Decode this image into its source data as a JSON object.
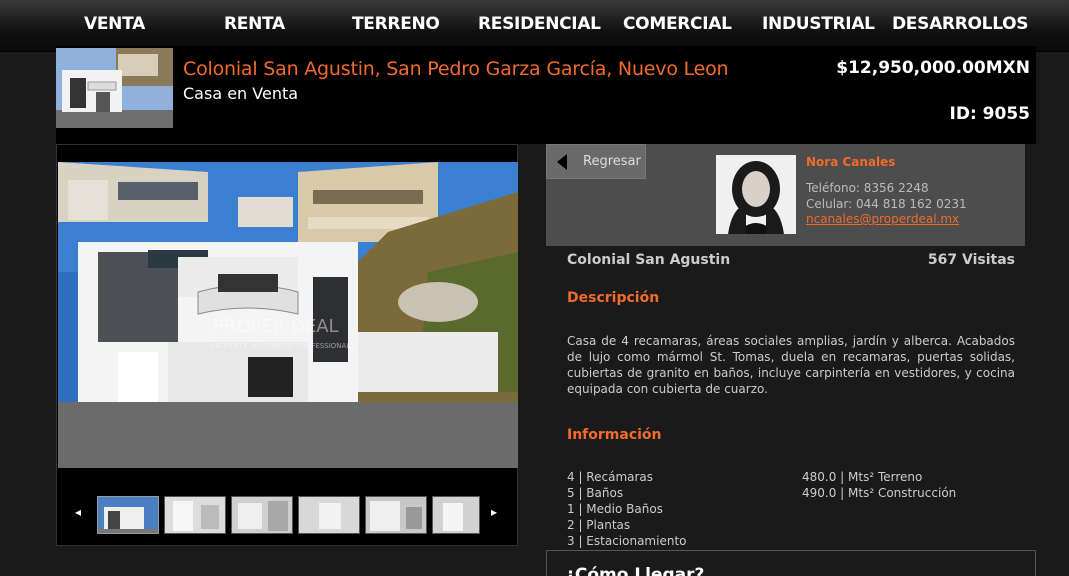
{
  "nav": [
    "VENTA",
    "RENTA",
    "TERRENO",
    "RESIDENCIAL",
    "COMERCIAL",
    "INDUSTRIAL",
    "DESARROLLOS"
  ],
  "listing": {
    "title": "Colonial San Agustin, San Pedro Garza García, Nuevo Leon",
    "subtitle": "Casa en Venta",
    "price": "$12,950,000.00MXN",
    "id": "ID: 9055"
  },
  "gallery": {
    "watermark": "PROPER DEAL",
    "watermark_sub": "PROPERTY INVESTMENT PROFESSIONALS",
    "prev_icon": "◂",
    "next_icon": "▸"
  },
  "agent": {
    "back_label": "Regresar",
    "name": "Nora Canales",
    "phone": "Teléfono: 8356 2248",
    "mobile": "Celular: 044 818 162 0231",
    "email": "ncanales@properdeal.mx"
  },
  "details": {
    "location": "Colonial San Agustin",
    "visits": "567 Visitas",
    "description_heading": "Descripción",
    "description": "Casa de 4 recamaras, áreas sociales amplias, jardín y alberca. Acabados de lujo como mármol St. Tomas, duela en recamaras, puertas solidas, cubiertas de granito en baños, incluye carpintería en vestidores, y cocina equipada con cubierta de cuarzo.",
    "info_heading": "Información",
    "info_left": [
      "4 | Recámaras",
      "5 | Baños",
      "1 | Medio Baños",
      "2 | Plantas",
      "3 | Estacionamiento"
    ],
    "info_right": [
      "480.0 | Mts² Terreno",
      "490.0 | Mts² Construcción"
    ],
    "how_heading": "¿Cómo Llegar?"
  },
  "colors": {
    "accent": "#f26b2a",
    "background": "#1a1a1a",
    "panel": "#4d4d4d"
  }
}
